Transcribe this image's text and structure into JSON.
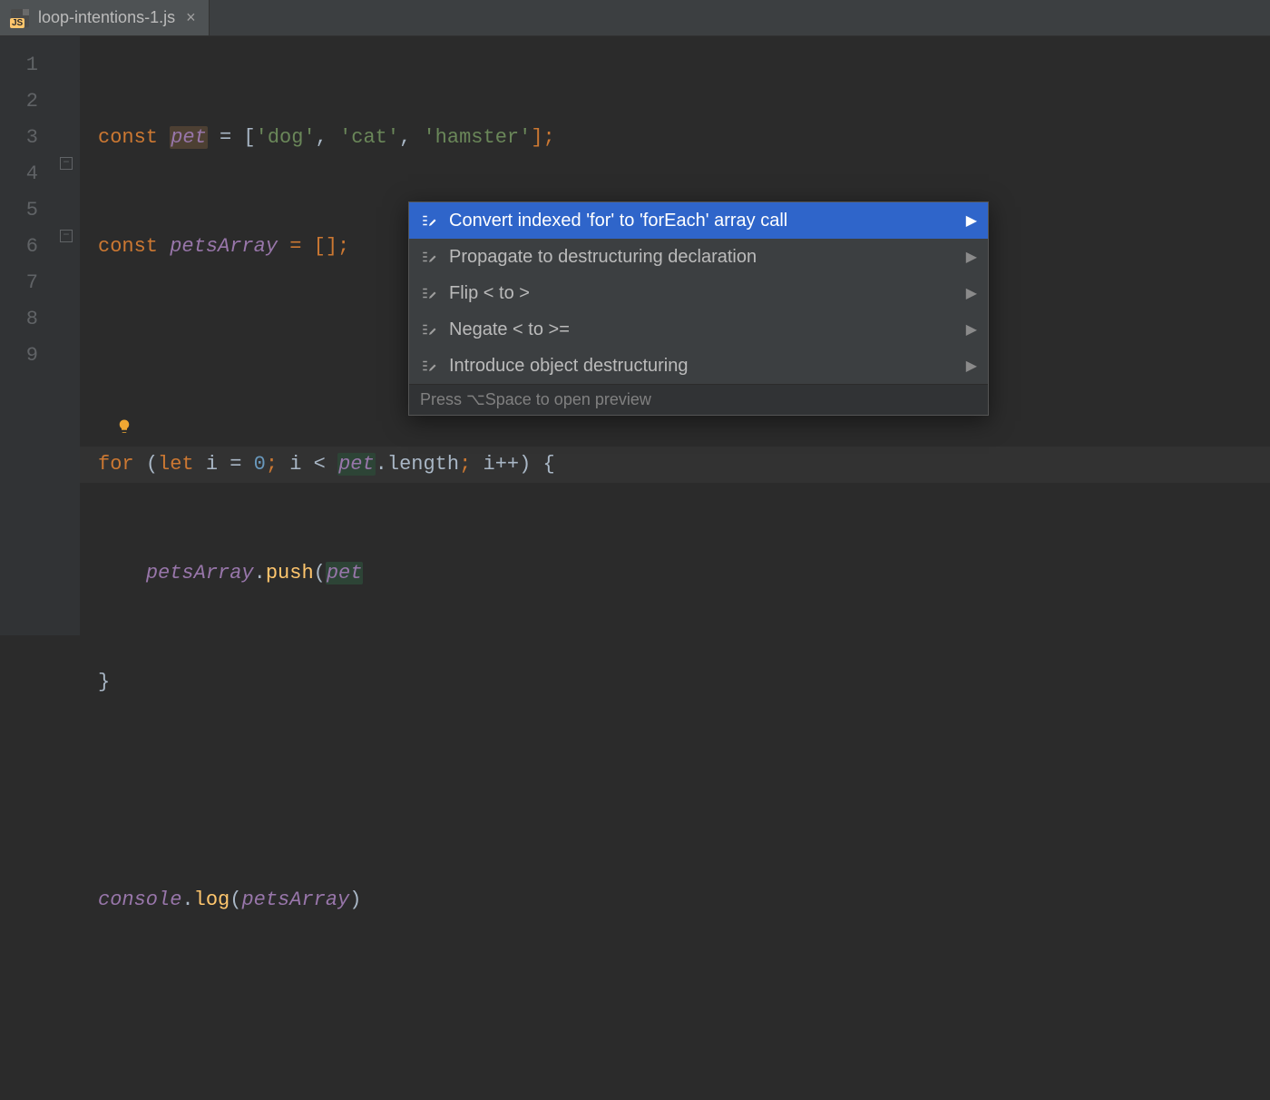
{
  "tab": {
    "filename": "loop-intentions-1.js"
  },
  "gutter": {
    "lines": [
      "1",
      "2",
      "3",
      "4",
      "5",
      "6",
      "7",
      "8",
      "9"
    ]
  },
  "code": {
    "line1": {
      "kw": "const ",
      "var": "pet",
      "assign": " = [",
      "s1": "'dog'",
      "c1": ", ",
      "s2": "'cat'",
      "c2": ", ",
      "s3": "'hamster'",
      "end": "];"
    },
    "line2": {
      "kw": "const ",
      "var": "petsArray",
      "rest": " = [];"
    },
    "line4": {
      "kw": "for ",
      "open": "(",
      "let": "let ",
      "i1": "i",
      "eq": " = ",
      "zero": "0",
      "semi1": "; ",
      "i2": "i ",
      "lt": "< ",
      "pet": "pet",
      "dotlen": ".length",
      "semi2": "; ",
      "i3": "i",
      "pp": "++",
      "close": ") {"
    },
    "line5": {
      "indent": "    ",
      "arr": "petsArray",
      "dot": ".",
      "push": "push",
      "open": "(",
      "pet": "pet"
    },
    "line6": {
      "brace": "}"
    },
    "line8": {
      "console": "console",
      "dot": ".",
      "log": "log",
      "open": "(",
      "arr": "petsArray",
      "close": ")"
    }
  },
  "intentions": {
    "items": [
      {
        "label": "Convert indexed 'for' to 'forEach' array call",
        "selected": true
      },
      {
        "label": "Propagate to destructuring declaration",
        "selected": false
      },
      {
        "label": "Flip < to >",
        "selected": false
      },
      {
        "label": "Negate < to >=",
        "selected": false
      },
      {
        "label": "Introduce object destructuring",
        "selected": false
      }
    ],
    "footer": "Press ⌥Space to open preview"
  }
}
